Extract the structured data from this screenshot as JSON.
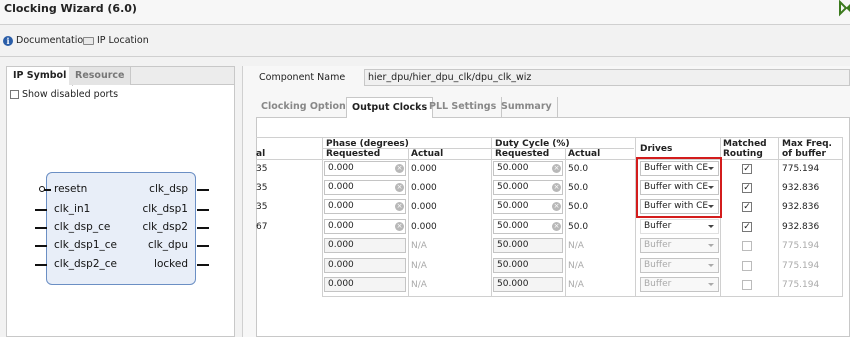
{
  "window": {
    "title": "Clocking Wizard (6.0)"
  },
  "toolbar": {
    "documentation": "Documentation",
    "ip_location": "IP Location"
  },
  "left_panel": {
    "tabs": [
      "IP Symbol",
      "Resource"
    ],
    "show_disabled_ports": "Show disabled ports",
    "ports_left": [
      "resetn",
      "clk_in1",
      "clk_dsp_ce",
      "clk_dsp1_ce",
      "clk_dsp2_ce"
    ],
    "ports_right": [
      "clk_dsp",
      "clk_dsp1",
      "clk_dsp2",
      "clk_dpu",
      "locked"
    ]
  },
  "component": {
    "label": "Component Name",
    "value": "hier_dpu/hier_dpu_clk/dpu_clk_wiz"
  },
  "tabs": [
    "Clocking Options",
    "Output Clocks",
    "PLL Settings",
    "Summary"
  ],
  "table": {
    "group_headers": {
      "phase": "Phase (degrees)",
      "duty": "Duty Cycle (%)",
      "drives": "Drives",
      "matched": "Matched Routing",
      "maxfreq": "Max Freq. of buffer"
    },
    "sub_headers": {
      "partial": "al",
      "phase_req": "Requested",
      "phase_act": "Actual",
      "duty_req": "Requested",
      "duty_act": "Actual"
    },
    "rows": [
      {
        "partial": "35",
        "phase_req": "0.000",
        "phase_act": "0.000",
        "duty_req": "50.000",
        "duty_act": "50.0",
        "drives": "Buffer with CE",
        "matched": true,
        "maxfreq": "775.194",
        "enabled": true
      },
      {
        "partial": "35",
        "phase_req": "0.000",
        "phase_act": "0.000",
        "duty_req": "50.000",
        "duty_act": "50.0",
        "drives": "Buffer with CE",
        "matched": true,
        "maxfreq": "932.836",
        "enabled": true
      },
      {
        "partial": "35",
        "phase_req": "0.000",
        "phase_act": "0.000",
        "duty_req": "50.000",
        "duty_act": "50.0",
        "drives": "Buffer with CE",
        "matched": true,
        "maxfreq": "932.836",
        "enabled": true
      },
      {
        "partial": "67",
        "phase_req": "0.000",
        "phase_act": "0.000",
        "duty_req": "50.000",
        "duty_act": "50.0",
        "drives": "Buffer",
        "matched": true,
        "maxfreq": "932.836",
        "enabled": true
      },
      {
        "partial": "",
        "phase_req": "0.000",
        "phase_act": "N/A",
        "duty_req": "50.000",
        "duty_act": "N/A",
        "drives": "Buffer",
        "matched": false,
        "maxfreq": "775.194",
        "enabled": false
      },
      {
        "partial": "",
        "phase_req": "0.000",
        "phase_act": "N/A",
        "duty_req": "50.000",
        "duty_act": "N/A",
        "drives": "Buffer",
        "matched": false,
        "maxfreq": "775.194",
        "enabled": false
      },
      {
        "partial": "",
        "phase_req": "0.000",
        "phase_act": "N/A",
        "duty_req": "50.000",
        "duty_act": "N/A",
        "drives": "Buffer",
        "matched": false,
        "maxfreq": "775.194",
        "enabled": false
      }
    ]
  },
  "colors": {
    "highlight": "#d31c1c",
    "symbol_fill": "#e8eef8",
    "symbol_border": "#6b8fc4"
  },
  "icons": {
    "info": "info-icon",
    "folder": "folder-icon",
    "clear": "clear-icon",
    "dropdown": "chevron-down-icon"
  }
}
